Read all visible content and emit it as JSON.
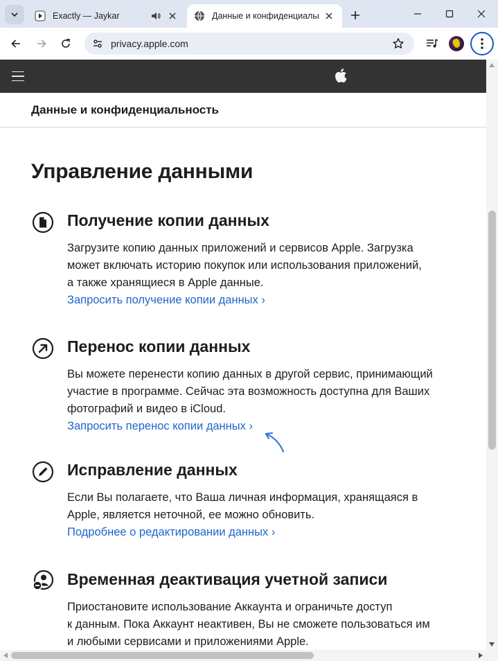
{
  "browser": {
    "tabs": [
      {
        "title": "Exactly — Jaykar",
        "favicon": "play-icon",
        "audio": true,
        "active": false
      },
      {
        "title": "Данные и конфиденциальность",
        "favicon": "globe-icon",
        "active": true
      }
    ],
    "url": "privacy.apple.com"
  },
  "page": {
    "subnav_title": "Данные и конфиденциальность",
    "heading": "Управление данными",
    "sections": [
      {
        "icon": "document-icon",
        "title": "Получение копии данных",
        "body": [
          "Загрузите копию данных приложений и сервисов Apple. Загрузка",
          "может включать историю покупок или использования приложений,",
          "а также хранящиеся в Apple данные."
        ],
        "link": "Запросить получение копии данных ›"
      },
      {
        "icon": "arrow-up-right-icon",
        "title": "Перенос копии данных",
        "body": [
          "Вы можете перенести копию данных в другой сервис, принимающий",
          "участие в программе. Сейчас эта возможность доступна для Ваших",
          "фотографий и видео в iCloud."
        ],
        "link": "Запросить перенос копии данных ›"
      },
      {
        "icon": "pencil-icon",
        "title": "Исправление данных",
        "body": [
          "Если Вы полагаете, что Ваша личная информация, хранящаяся в",
          "Apple, является неточной, ее можно обновить."
        ],
        "link": "Подробнее о редактировании данных ›"
      },
      {
        "icon": "user-minus-icon",
        "title": "Временная деактивация учетной записи",
        "body": [
          "Приостановите использование Аккаунта и ограничьте доступ",
          "к данным. Пока Аккаунт неактивен, Вы не сможете пользоваться им",
          "и любыми сервисами и приложениями Apple."
        ],
        "link": ""
      }
    ]
  },
  "colors": {
    "link": "#2166c7",
    "nav_bg": "#333333",
    "annotation_arrow": "#2f6fd0"
  }
}
